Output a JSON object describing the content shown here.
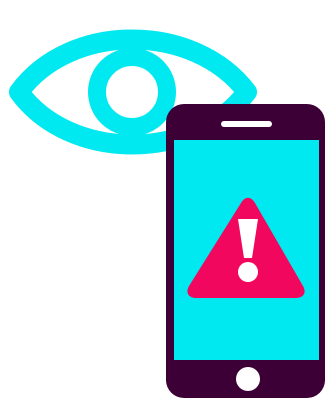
{
  "illustration": {
    "icons": [
      "eye-icon",
      "smartphone-icon",
      "warning-triangle-icon",
      "exclamation-icon"
    ],
    "colors": {
      "eye": "#00e8f0",
      "phone_frame": "#3d0036",
      "phone_screen": "#00e8f0",
      "warning": "#f2075e",
      "accent_white": "#ffffff",
      "background": "#ffffff"
    }
  }
}
